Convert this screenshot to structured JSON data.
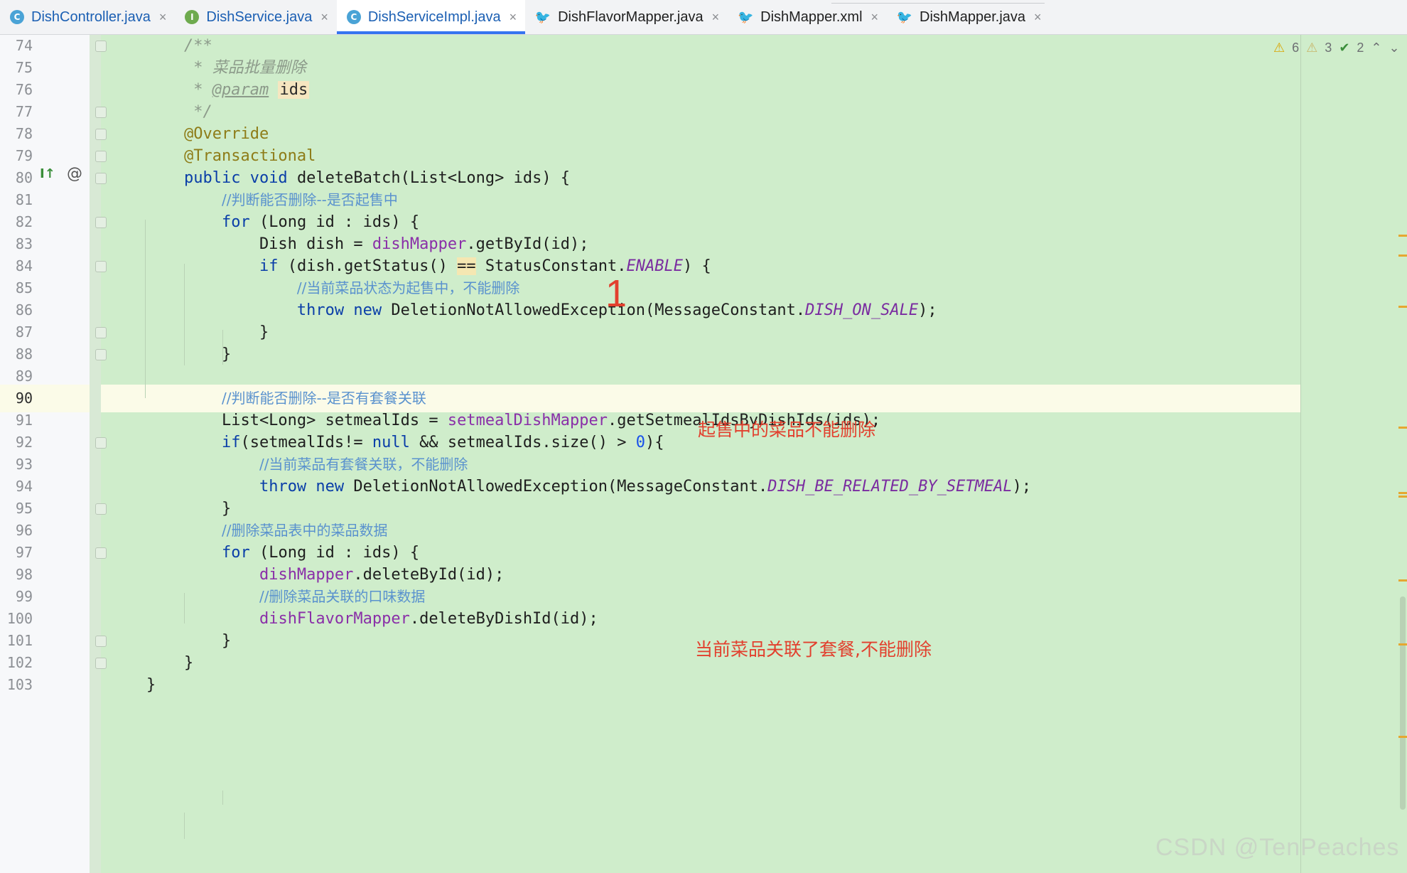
{
  "tabs": [
    {
      "label": "DishController.java",
      "icon": "class-icon",
      "icon_glyph": "C"
    },
    {
      "label": "DishService.java",
      "icon": "interface-icon",
      "icon_glyph": "I"
    },
    {
      "label": "DishServiceImpl.java",
      "icon": "class-icon",
      "icon_glyph": "C",
      "active": true
    },
    {
      "label": "DishFlavorMapper.java",
      "icon": "mybatis-icon",
      "icon_glyph": "🐦"
    },
    {
      "label": "DishMapper.xml",
      "icon": "mybatis-icon",
      "icon_glyph": "🐦"
    },
    {
      "label": "DishMapper.java",
      "icon": "mybatis-icon",
      "icon_glyph": "🐦"
    }
  ],
  "tab_close_glyph": "×",
  "inspections": {
    "warnings": "6",
    "weak_warnings": "3",
    "typos": "2",
    "warn_glyph": "⚠",
    "weak_glyph": "⚠",
    "ok_glyph": "✔",
    "up_glyph": "⌃",
    "down_glyph": "⌄"
  },
  "gutter": {
    "impl_icon_glyph": "I↑",
    "at_icon_glyph": "@"
  },
  "editor": {
    "current_line": 90,
    "lines": [
      {
        "n": "74",
        "html": "    <span class=\"doc\">/**</span>"
      },
      {
        "n": "75",
        "html": "     <span class=\"doc\">* 菜品批量删除</span>"
      },
      {
        "n": "76",
        "html": "     <span class=\"doc\">* </span><span class=\"doctag\">@param</span> <span class=\"docparam\">ids</span>"
      },
      {
        "n": "77",
        "html": "     <span class=\"doc\">*/</span>"
      },
      {
        "n": "78",
        "html": "    <span class=\"ann\">@Override</span>"
      },
      {
        "n": "79",
        "html": "    <span class=\"ann\">@Transactional</span>"
      },
      {
        "n": "80",
        "html": "    <span class=\"kw\">public void</span> <span class=\"meth\">deleteBatch</span>(List&lt;Long&gt; ids) {"
      },
      {
        "n": "81",
        "html": "        <span class=\"cmt\">//判断能否删除--是否起售中</span>"
      },
      {
        "n": "82",
        "html": "        <span class=\"kw\">for</span> (Long id : ids) {"
      },
      {
        "n": "83",
        "html": "            Dish dish = <span class=\"fld\">dishMapper</span>.getById(id);"
      },
      {
        "n": "84",
        "html": "            <span class=\"kw\">if</span> (dish.getStatus() <span class=\"eqhl\">==</span> StatusConstant.<span class=\"const\">ENABLE</span>) {"
      },
      {
        "n": "85",
        "html": "                <span class=\"cmt\">//当前菜品状态为起售中，不能删除</span>"
      },
      {
        "n": "86",
        "html": "                <span class=\"kw\">throw new</span> DeletionNotAllowedException(MessageConstant.<span class=\"const\">DISH_ON_SALE</span>);"
      },
      {
        "n": "87",
        "html": "            }"
      },
      {
        "n": "88",
        "html": "        }"
      },
      {
        "n": "89",
        "html": ""
      },
      {
        "n": "90",
        "html": "        <span class=\"cmt\">//判断能否删除--是否有套餐关联</span>"
      },
      {
        "n": "91",
        "html": "        List&lt;Long&gt; setmealIds = <span class=\"fld\">setmealDishMapper</span>.getSetmealIdsByDishIds(ids);"
      },
      {
        "n": "92",
        "html": "        <span class=\"kw\">if</span>(setmealIds!= <span class=\"kw\">null</span> &amp;&amp; setmealIds.size() &gt; <span class=\"num\">0</span>){"
      },
      {
        "n": "93",
        "html": "            <span class=\"cmt\">//当前菜品有套餐关联，不能删除</span>"
      },
      {
        "n": "94",
        "html": "            <span class=\"kw\">throw new</span> DeletionNotAllowedException(MessageConstant.<span class=\"const\">DISH_BE_RELATED_BY_SETMEAL</span>);"
      },
      {
        "n": "95",
        "html": "        }"
      },
      {
        "n": "96",
        "html": "        <span class=\"cmt\">//删除菜品表中的菜品数据</span>"
      },
      {
        "n": "97",
        "html": "        <span class=\"kw\">for</span> (Long id : ids) {"
      },
      {
        "n": "98",
        "html": "            <span class=\"fld\">dishMapper</span>.deleteById(id);"
      },
      {
        "n": "99",
        "html": "            <span class=\"cmt\">//删除菜品关联的口味数据</span>"
      },
      {
        "n": "100",
        "html": "            <span class=\"fld\">dishFlavorMapper</span>.deleteByDishId(id);"
      },
      {
        "n": "101",
        "html": "        }"
      },
      {
        "n": "102",
        "html": "    }"
      },
      {
        "n": "103",
        "html": "}"
      }
    ]
  },
  "annotations": {
    "number": "1",
    "on_sale": "起售中的菜品不能删除",
    "setmeal": "当前菜品关联了套餐,不能删除"
  },
  "watermark": "CSDN @TenPeaches",
  "colors": {
    "editor_bg": "#cfedcb",
    "active_tab_underline": "#3574f0",
    "annotation": "#e2402e"
  }
}
